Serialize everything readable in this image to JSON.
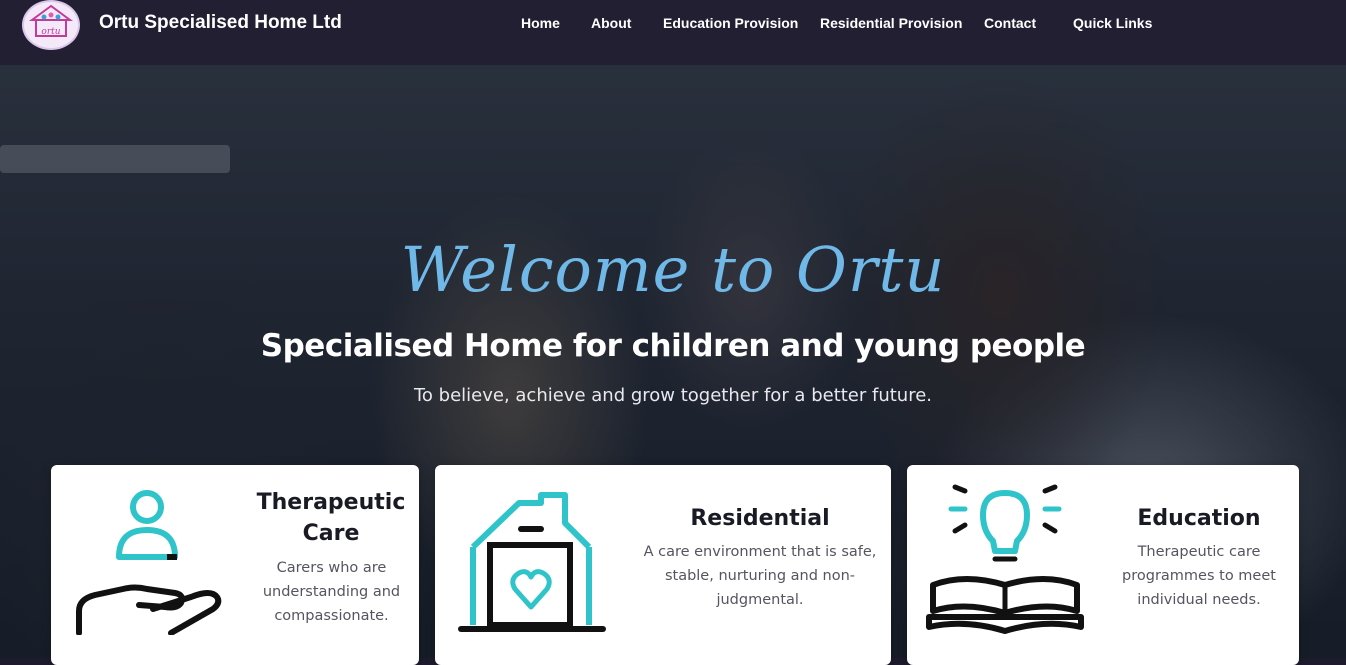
{
  "brand": {
    "name": "Ortu Specialised Home Ltd",
    "logo_text": "ORTU",
    "logo_icon": "house-family-logo"
  },
  "nav": {
    "items": [
      {
        "label": "Home"
      },
      {
        "label": "About"
      },
      {
        "label": "Education Provision"
      },
      {
        "label": "Residential Provision"
      },
      {
        "label": "Contact"
      },
      {
        "label": "Quick Links"
      }
    ]
  },
  "hero": {
    "welcome": "Welcome to Ortu",
    "title": "Specialised Home for children and young people",
    "subtitle": "To believe, achieve and grow together for a better future."
  },
  "cards": [
    {
      "title": "Therapeutic Care",
      "text": "Carers who are understanding and compassionate.",
      "icon": "hand-person-icon"
    },
    {
      "title": "Residential",
      "text": "A care environment that is safe, stable, nurturing and non-judgmental.",
      "icon": "house-heart-icon"
    },
    {
      "title": "Education",
      "text": "Therapeutic care programmes to meet individual needs.",
      "icon": "book-lightbulb-icon"
    }
  ],
  "colors": {
    "navbar": "#221f33",
    "accent": "#2ec4c9",
    "welcome_text": "#6fb8e8"
  }
}
